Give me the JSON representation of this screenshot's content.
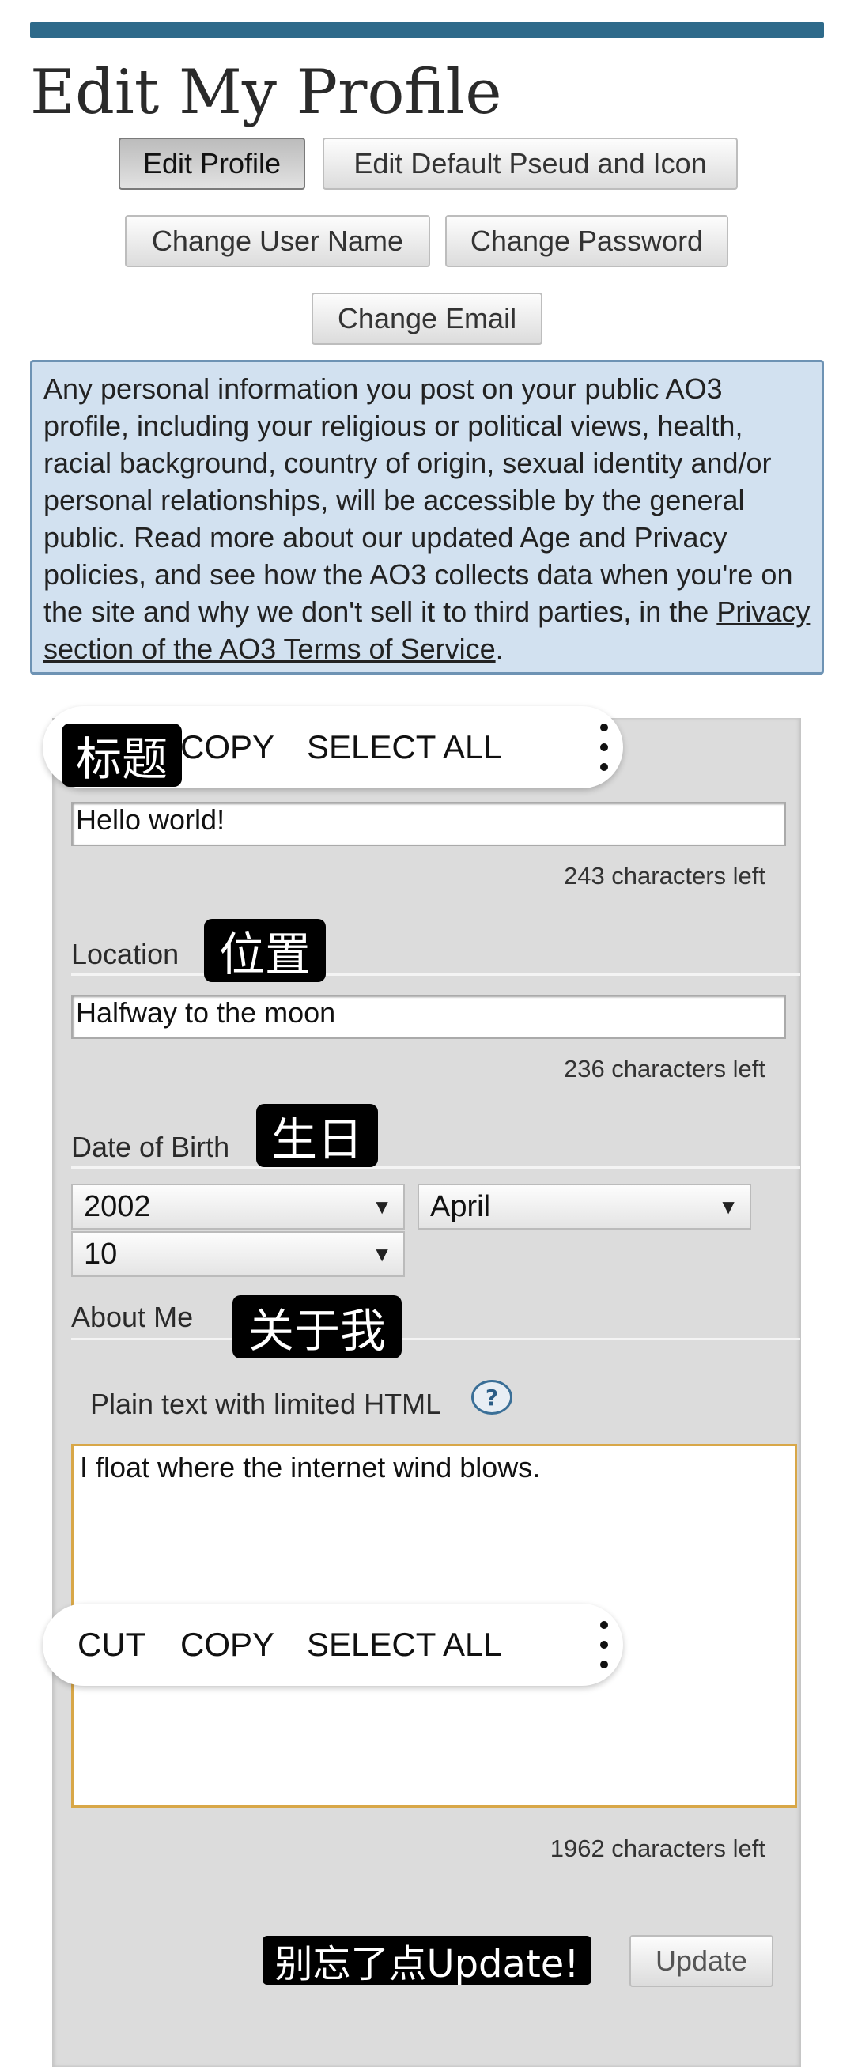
{
  "page": {
    "title": "Edit My Profile"
  },
  "nav": {
    "edit_profile": "Edit Profile",
    "edit_pseud": "Edit Default Pseud and Icon",
    "change_username": "Change User Name",
    "change_password": "Change Password",
    "change_email": "Change Email"
  },
  "notice": {
    "text": "Any personal information you post on your public AO3 profile, including your religious or political views, health, racial background, country of origin, sexual identity and/or personal relationships, will be accessible by the general public. Read more about our updated Age and Privacy policies, and see how the AO3 collects data when you're on the site and why we don't sell it to third parties, in the ",
    "link": "Privacy section of the AO3 Terms of Service",
    "end": "."
  },
  "form": {
    "title_value": "Hello world!",
    "title_counter": "243 characters left",
    "location_label": "Location",
    "location_value": "Halfway to the moon",
    "location_counter": "236 characters left",
    "dob_label": "Date of Birth",
    "dob_year": "2002",
    "dob_month": "April",
    "dob_day": "10",
    "about_label": "About Me",
    "html_hint": "Plain text with limited HTML",
    "help_symbol": "?",
    "about_value": "I float where the internet wind blows.",
    "about_counter": "1962 characters left",
    "update_label": "Update"
  },
  "context_menu_top": {
    "copy": "COPY",
    "select_all": "SELECT ALL"
  },
  "context_menu_bottom": {
    "cut": "CUT",
    "copy": "COPY",
    "select_all": "SELECT ALL"
  },
  "annotations": {
    "title": "标题",
    "location": "位置",
    "birthday": "生日",
    "about": "关于我",
    "update_reminder": "别忘了点Update!"
  },
  "icons": {
    "dropdown": "▼",
    "more": "more-vert-icon"
  },
  "colors": {
    "topbar": "#2e6a8a",
    "notice_bg": "#d2e1f0",
    "textarea_focus": "#d8a748"
  }
}
